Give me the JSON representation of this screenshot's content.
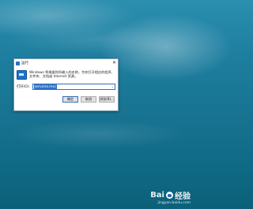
{
  "dialog": {
    "title": "运行",
    "close_glyph": "✕",
    "description": "Windows 将根据你所输入的名称，为你打开相应的程序、文件夹、文档或 Internet 资源。",
    "open_label": "打开(O):",
    "open_value": "services.msc",
    "dropdown_glyph": "⌄",
    "ok_label": "确定",
    "cancel_label": "取消",
    "browse_label": "浏览(B)..."
  },
  "watermark": {
    "brand_left": "Bai",
    "brand_right": "经验",
    "url": "jingyan.baidu.com"
  }
}
